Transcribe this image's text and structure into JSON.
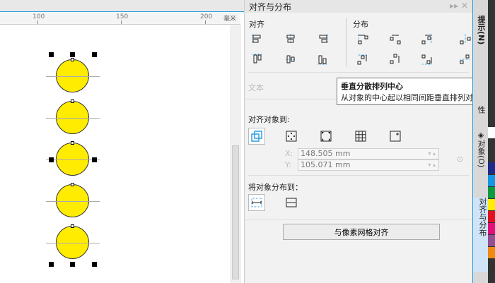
{
  "ruler": {
    "unit": "毫米",
    "labels": [
      "100",
      "150",
      "200"
    ]
  },
  "panel": {
    "title": "对齐与分布",
    "align_label": "对齐",
    "distribute_label": "分布",
    "text_label": "文本",
    "align_to_label": "对齐对象到:",
    "x_label": "X:",
    "x_value": "148.505 mm",
    "y_label": "Y:",
    "y_value": "105.071 mm",
    "distribute_to_label": "将对象分布到：",
    "pixel_grid_button": "与像素网格对齐"
  },
  "tooltip": {
    "title": "垂直分散排列中心",
    "body": "从对象的中心起以相同间距垂直排列对象。"
  },
  "tabs": {
    "hints": "提示(N)",
    "properties": "性",
    "objects": "对象(O)",
    "align": "对齐与分布"
  },
  "colors": {
    "accent": "#2a9de0",
    "fill": "#ffec00"
  }
}
